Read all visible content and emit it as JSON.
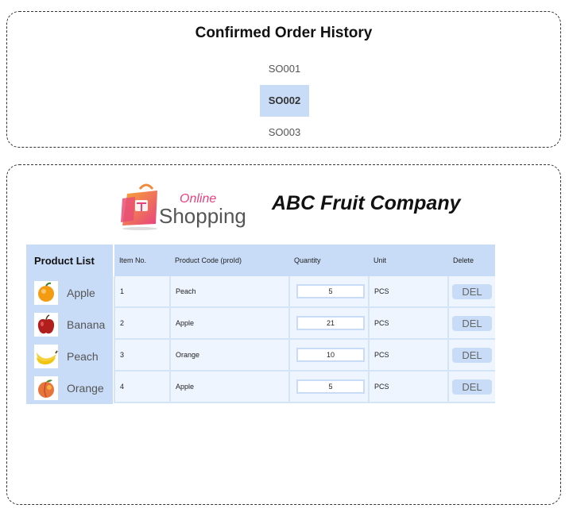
{
  "history": {
    "title": "Confirmed Order History",
    "orders": [
      "SO001",
      "SO002",
      "SO003"
    ],
    "selected": "SO002"
  },
  "logo": {
    "line1": "Online",
    "line2": "Shopping"
  },
  "company": "ABC Fruit Company",
  "product_list": {
    "title": "Product List",
    "items": [
      {
        "name": "Apple",
        "icon": "orange-icon"
      },
      {
        "name": "Banana",
        "icon": "apple-icon"
      },
      {
        "name": "Peach",
        "icon": "banana-icon"
      },
      {
        "name": "Orange",
        "icon": "peach-icon"
      }
    ]
  },
  "table": {
    "headers": [
      "Item No.",
      "Product Code (proId)",
      "Quantity",
      "Unit",
      "Delete"
    ],
    "rows": [
      {
        "item_no": "1",
        "code": "Peach",
        "qty": "5",
        "unit": "PCS",
        "del": "DEL"
      },
      {
        "item_no": "2",
        "code": "Apple",
        "qty": "21",
        "unit": "PCS",
        "del": "DEL"
      },
      {
        "item_no": "3",
        "code": "Orange",
        "qty": "10",
        "unit": "PCS",
        "del": "DEL"
      },
      {
        "item_no": "4",
        "code": "Apple",
        "qty": "5",
        "unit": "PCS",
        "del": "DEL"
      }
    ]
  },
  "colors": {
    "accent": "#c9dcf7",
    "cell": "#eef5fe"
  }
}
